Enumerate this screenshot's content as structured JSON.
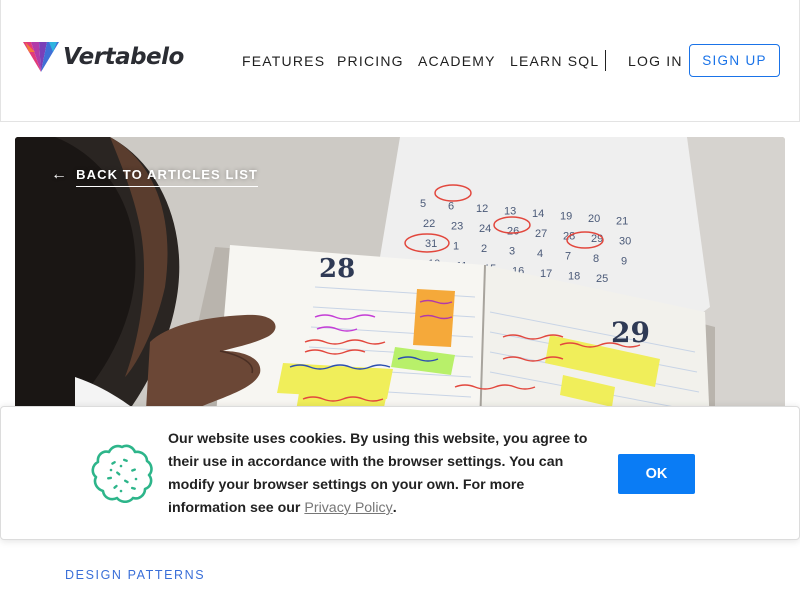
{
  "header": {
    "logo_text": "Vertabelo",
    "nav": [
      {
        "label": "FEATURES"
      },
      {
        "label": "PRICING"
      },
      {
        "label": "ACADEMY"
      },
      {
        "label": "LEARN SQL"
      },
      {
        "label": "LOG IN"
      }
    ],
    "signup_label": "SIGN UP"
  },
  "hero": {
    "back_label": "BACK TO ARTICLES LIST",
    "back_icon": "arrow-left-icon",
    "planner": {
      "left_day": "28",
      "right_day": "29",
      "calendar_numbers": [
        "5",
        "6",
        "12",
        "13",
        "14",
        "19",
        "20",
        "21",
        "22",
        "23",
        "24",
        "26",
        "27",
        "28",
        "29",
        "30",
        "31",
        "1",
        "2",
        "3",
        "4",
        "7",
        "8",
        "9",
        "10",
        "11",
        "15",
        "16",
        "17",
        "18",
        "25"
      ]
    }
  },
  "cookie_banner": {
    "icon": "cookie-icon",
    "text": "Our website uses cookies. By using this website, you agree to their use in accordance with the browser settings. You can modify your browser settings on your own. For more information see our ",
    "link_label": "Privacy Policy",
    "trailing": ".",
    "ok_label": "OK"
  },
  "article": {
    "category": "DESIGN PATTERNS"
  },
  "colors": {
    "accent": "#1a73e8",
    "ok_button": "#0a7cf5",
    "cookie_icon": "#2db58a"
  }
}
